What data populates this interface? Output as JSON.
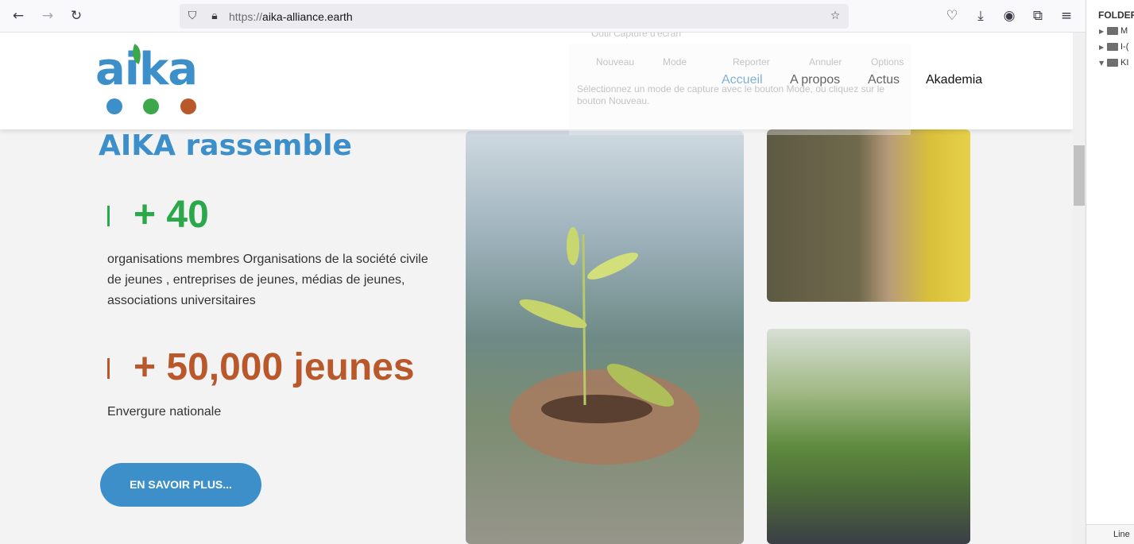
{
  "browser": {
    "url_protocol": "https://",
    "url_host": "aika-alliance.earth"
  },
  "site": {
    "logo_text": "aika",
    "logo_dot_colors": [
      "#3d8fca",
      "#3ca84a",
      "#b9582a"
    ],
    "nav": [
      "Accueil",
      "A propos",
      "Actus",
      "Akademia"
    ],
    "active_nav": "Accueil",
    "headline": "AIKA rassemble",
    "stats": [
      {
        "value": "+ 40",
        "color": "#2aa84a",
        "description": "organisations membres Organisations de la société civile de jeunes , entreprises de jeunes, médias de jeunes, associations universitaires"
      },
      {
        "value": "+ 50,000 jeunes",
        "color": "#b9582a",
        "description": "Envergure nationale"
      }
    ],
    "cta_label": "EN SAVOIR PLUS...",
    "accent_color": "#3d8fca"
  },
  "snipping_tool": {
    "title": "Outil Capture d'écran",
    "buttons": [
      "Nouveau",
      "Mode",
      "Reporter",
      "Annuler",
      "Options"
    ],
    "hint": "Sélectionnez un mode de capture avec le bouton Mode, ou cliquez sur le bouton Nouveau."
  },
  "side_panel": {
    "title": "FOLDERS",
    "rows": [
      "M",
      "I-(",
      "KI"
    ],
    "footer": "Line"
  }
}
